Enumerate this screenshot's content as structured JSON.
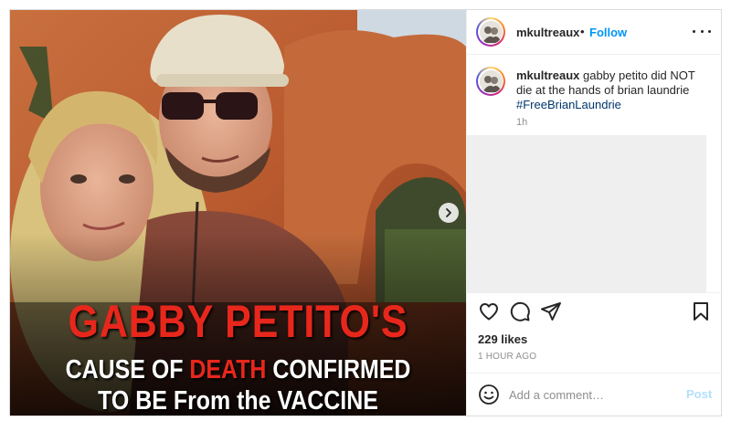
{
  "post": {
    "image": {
      "headline": "GABBY PETITO'S",
      "subline_1_before": "CAUSE OF ",
      "subline_1_red": "DEATH",
      "subline_1_after": " CONFIRMED",
      "subline_2": "TO BE From the VACCINE"
    },
    "header": {
      "username": "mkultreaux",
      "separator": "•",
      "follow_label": "Follow",
      "more_icon": "more-horizontal-icon"
    },
    "caption": {
      "username": "mkultreaux",
      "text": " gabby petito did NOT die at the hands of brian laundrie ",
      "hashtag": "#FreeBrianLaundrie",
      "time": "1h"
    },
    "actions": {
      "icons": [
        "heart-icon",
        "comment-icon",
        "share-icon",
        "bookmark-icon"
      ],
      "likes": "229 likes",
      "posted": "1 HOUR AGO"
    },
    "comment_box": {
      "placeholder": "Add a comment…",
      "post_label": "Post"
    }
  },
  "colors": {
    "follow_blue": "#0095f6",
    "hashtag_blue": "#00376b",
    "headline_red": "#e8271c",
    "post_disabled": "#b2dffc"
  }
}
